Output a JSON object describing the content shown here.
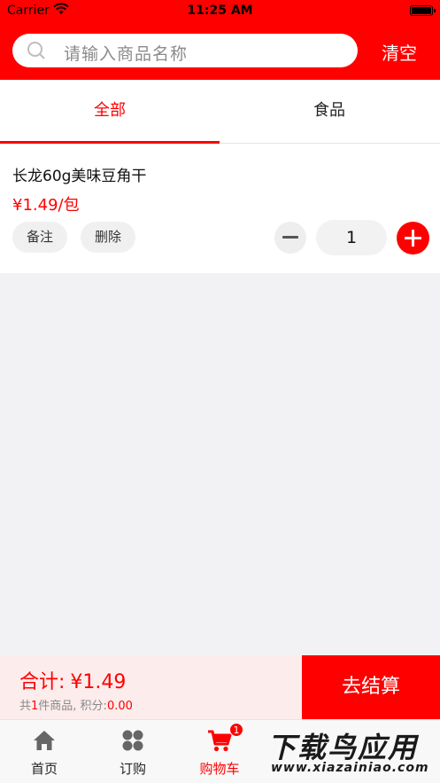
{
  "status_bar": {
    "carrier": "Carrier",
    "time": "11:25 AM"
  },
  "header": {
    "search_placeholder": "请输入商品名称",
    "clear_label": "清空"
  },
  "tabs": [
    {
      "label": "全部",
      "active": true
    },
    {
      "label": "食品",
      "active": false
    }
  ],
  "cart_items": [
    {
      "name": "长龙60g美味豆角干",
      "price": "¥1.49/包",
      "note_label": "备注",
      "delete_label": "删除",
      "quantity": "1"
    }
  ],
  "summary": {
    "total_label": "合计:",
    "total_amount": "¥1.49",
    "sub_prefix": "共",
    "item_count": "1",
    "sub_middle": "件商品, 积分:",
    "points": "0.00",
    "checkout_label": "去结算"
  },
  "tabbar": {
    "items": [
      {
        "label": "首页",
        "icon": "home-icon"
      },
      {
        "label": "订购",
        "icon": "grid-icon"
      },
      {
        "label": "购物车",
        "icon": "cart-icon",
        "badge": "1",
        "active": true
      },
      {
        "label": "",
        "icon": "user-icon"
      }
    ]
  },
  "watermark": {
    "line1": "下载鸟应用",
    "line2": "www.xiazainiao.com"
  },
  "colors": {
    "accent": "#ff0000",
    "summary_bg": "#fdecec",
    "page_bg": "#f2f2f4"
  }
}
